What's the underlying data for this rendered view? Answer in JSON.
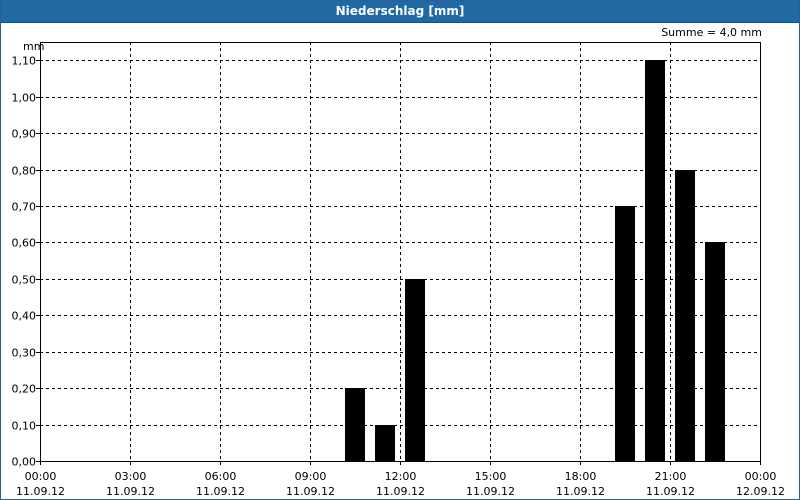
{
  "window": {
    "title": "Niederschlag [mm]"
  },
  "chart_data": {
    "type": "bar",
    "title": "Niederschlag [mm]",
    "ylabel": "mm",
    "annotation": "Summe = 4,0 mm",
    "ylim": [
      0,
      1.15
    ],
    "yticks": [
      "0,00",
      "0,10",
      "0,20",
      "0,30",
      "0,40",
      "0,50",
      "0,60",
      "0,70",
      "0,80",
      "0,90",
      "1,00",
      "1,10"
    ],
    "x_range_hours": [
      0,
      24
    ],
    "xticks": [
      {
        "time": "00:00",
        "date": "11.09.12"
      },
      {
        "time": "03:00",
        "date": "11.09.12"
      },
      {
        "time": "06:00",
        "date": "11.09.12"
      },
      {
        "time": "09:00",
        "date": "11.09.12"
      },
      {
        "time": "12:00",
        "date": "11.09.12"
      },
      {
        "time": "15:00",
        "date": "11.09.12"
      },
      {
        "time": "18:00",
        "date": "11.09.12"
      },
      {
        "time": "21:00",
        "date": "11.09.12"
      },
      {
        "time": "00:00",
        "date": "12.09.12"
      }
    ],
    "bars": [
      {
        "hour": 10.5,
        "value": 0.2
      },
      {
        "hour": 11.5,
        "value": 0.1
      },
      {
        "hour": 12.5,
        "value": 0.5
      },
      {
        "hour": 19.5,
        "value": 0.7
      },
      {
        "hour": 20.5,
        "value": 1.1
      },
      {
        "hour": 21.5,
        "value": 0.8
      },
      {
        "hour": 22.5,
        "value": 0.6
      }
    ],
    "grid": true,
    "colors": {
      "bar": "#000000",
      "titlebar": "#1f6aa5"
    }
  }
}
